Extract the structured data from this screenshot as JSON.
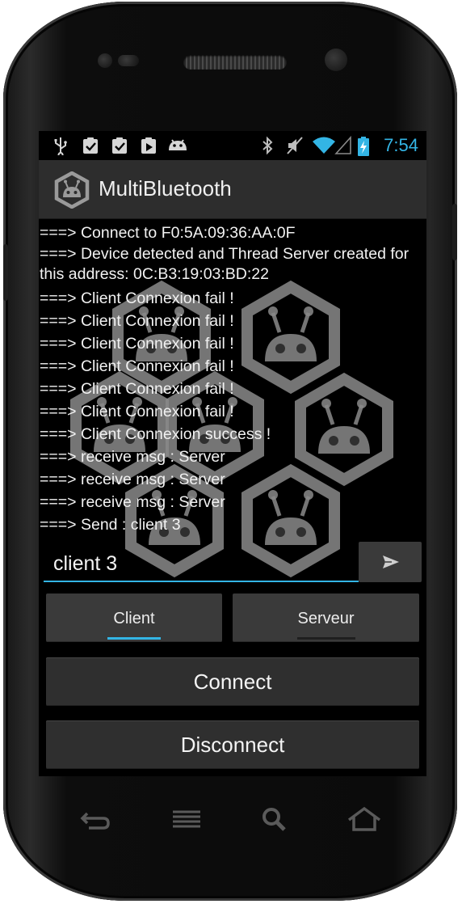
{
  "status_bar": {
    "time": "7:54",
    "left_icons": [
      "usb-icon",
      "clipboard-check-icon",
      "clipboard-check-icon",
      "clipboard-play-icon",
      "android-icon"
    ],
    "right_icons": [
      "bluetooth-icon",
      "mute-icon",
      "wifi-icon",
      "signal-icon",
      "battery-charging-icon"
    ]
  },
  "action_bar": {
    "title": "MultiBluetooth",
    "icon": "app-hexagon-android-icon"
  },
  "log": [
    "===> Connect to F0:5A:09:36:AA:0F",
    "===> Device detected and Thread Server created for this address: 0C:B3:19:03:BD:22",
    "===> Client Connexion fail !",
    "===> Client Connexion fail !",
    "===> Client Connexion fail !",
    "===> Client Connexion fail !",
    "===> Client Connexion fail !",
    "===> Client Connexion fail !",
    "===> Client Connexion success !",
    "===> receive msg : Server",
    "===> receive msg : Server",
    "===> receive msg : Server",
    "===> Send : client 3"
  ],
  "message_input": {
    "value": "client 3"
  },
  "send_button": {
    "icon": "send-icon"
  },
  "tabs": [
    {
      "label": "Client",
      "selected": true
    },
    {
      "label": "Serveur",
      "selected": false
    }
  ],
  "buttons": {
    "connect": "Connect",
    "disconnect": "Disconnect"
  },
  "nav_bar": {
    "icons": [
      "back-icon",
      "menu-icon",
      "search-icon",
      "home-icon"
    ]
  },
  "colors": {
    "accent": "#33b5e5",
    "background": "#000000",
    "button": "#3a3a3a"
  }
}
